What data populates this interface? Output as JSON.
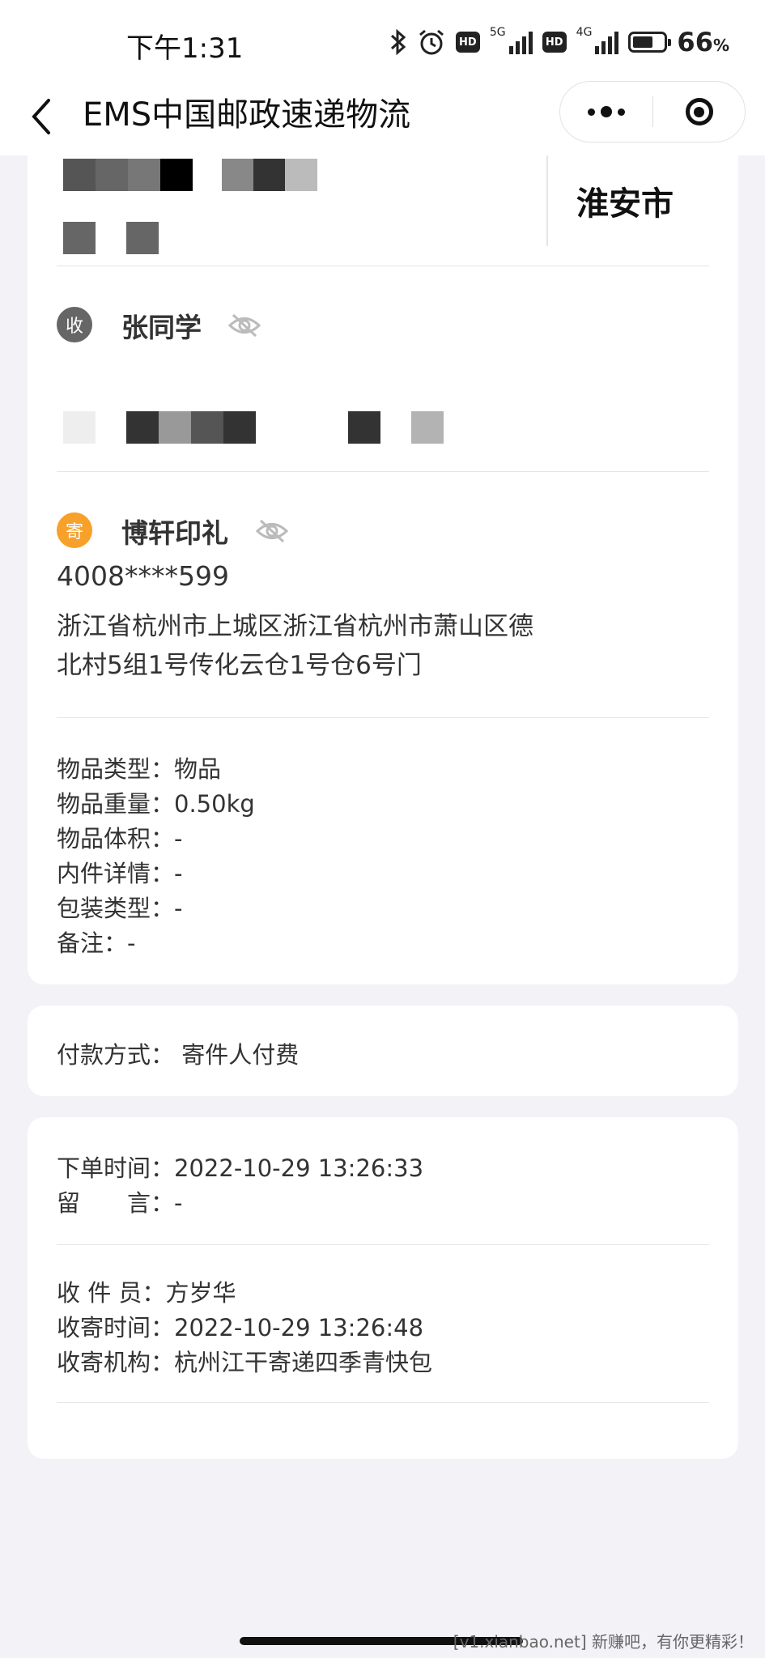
{
  "status_bar": {
    "time": "下午1:31",
    "net1": "5G",
    "net2": "4G",
    "hd": "HD",
    "battery_percent": "66",
    "battery_unit": "%",
    "battery_level": 0.66
  },
  "nav": {
    "title": "EMS中国邮政速递物流",
    "icons": [
      "back-arrow-icon",
      "more-dots-icon",
      "close-target-icon"
    ]
  },
  "shipment": {
    "city": "淮安市",
    "receiver": {
      "badge": "收",
      "name": "张同学"
    },
    "sender": {
      "badge": "寄",
      "name": "博轩印礼",
      "phone": "4008****599",
      "address_line1": "浙江省杭州市上城区浙江省杭州市萧山区德",
      "address_line2": "北村5组1号传化云仓1号仓6号门"
    },
    "details": [
      {
        "label": "物品类型：",
        "value": "物品"
      },
      {
        "label": "物品重量：",
        "value": "0.50kg"
      },
      {
        "label": "物品体积：",
        "value": "-"
      },
      {
        "label": "内件详情：",
        "value": "-"
      },
      {
        "label": "包装类型：",
        "value": "-"
      },
      {
        "label": "备注：",
        "value": "-"
      }
    ]
  },
  "payment": {
    "label": "付款方式：",
    "value": "寄件人付费"
  },
  "order": {
    "order_time_label": "下单时间：",
    "order_time": "2022-10-29 13:26:33",
    "message_label": "留　　言：",
    "message": "-",
    "collector_label": "收 件 员：",
    "collector": "方岁华",
    "collect_time_label": "收寄时间：",
    "collect_time": "2022-10-29 13:26:48",
    "collect_org_label": "收寄机构：",
    "collect_org": "杭州江干寄递四季青快包"
  },
  "watermark": "[v1.xianbao.net] 新赚吧，有你更精彩！",
  "colors": {
    "background": "#f2f2f7",
    "sender_badge": "#f7a12a",
    "receiver_badge": "#666666"
  }
}
